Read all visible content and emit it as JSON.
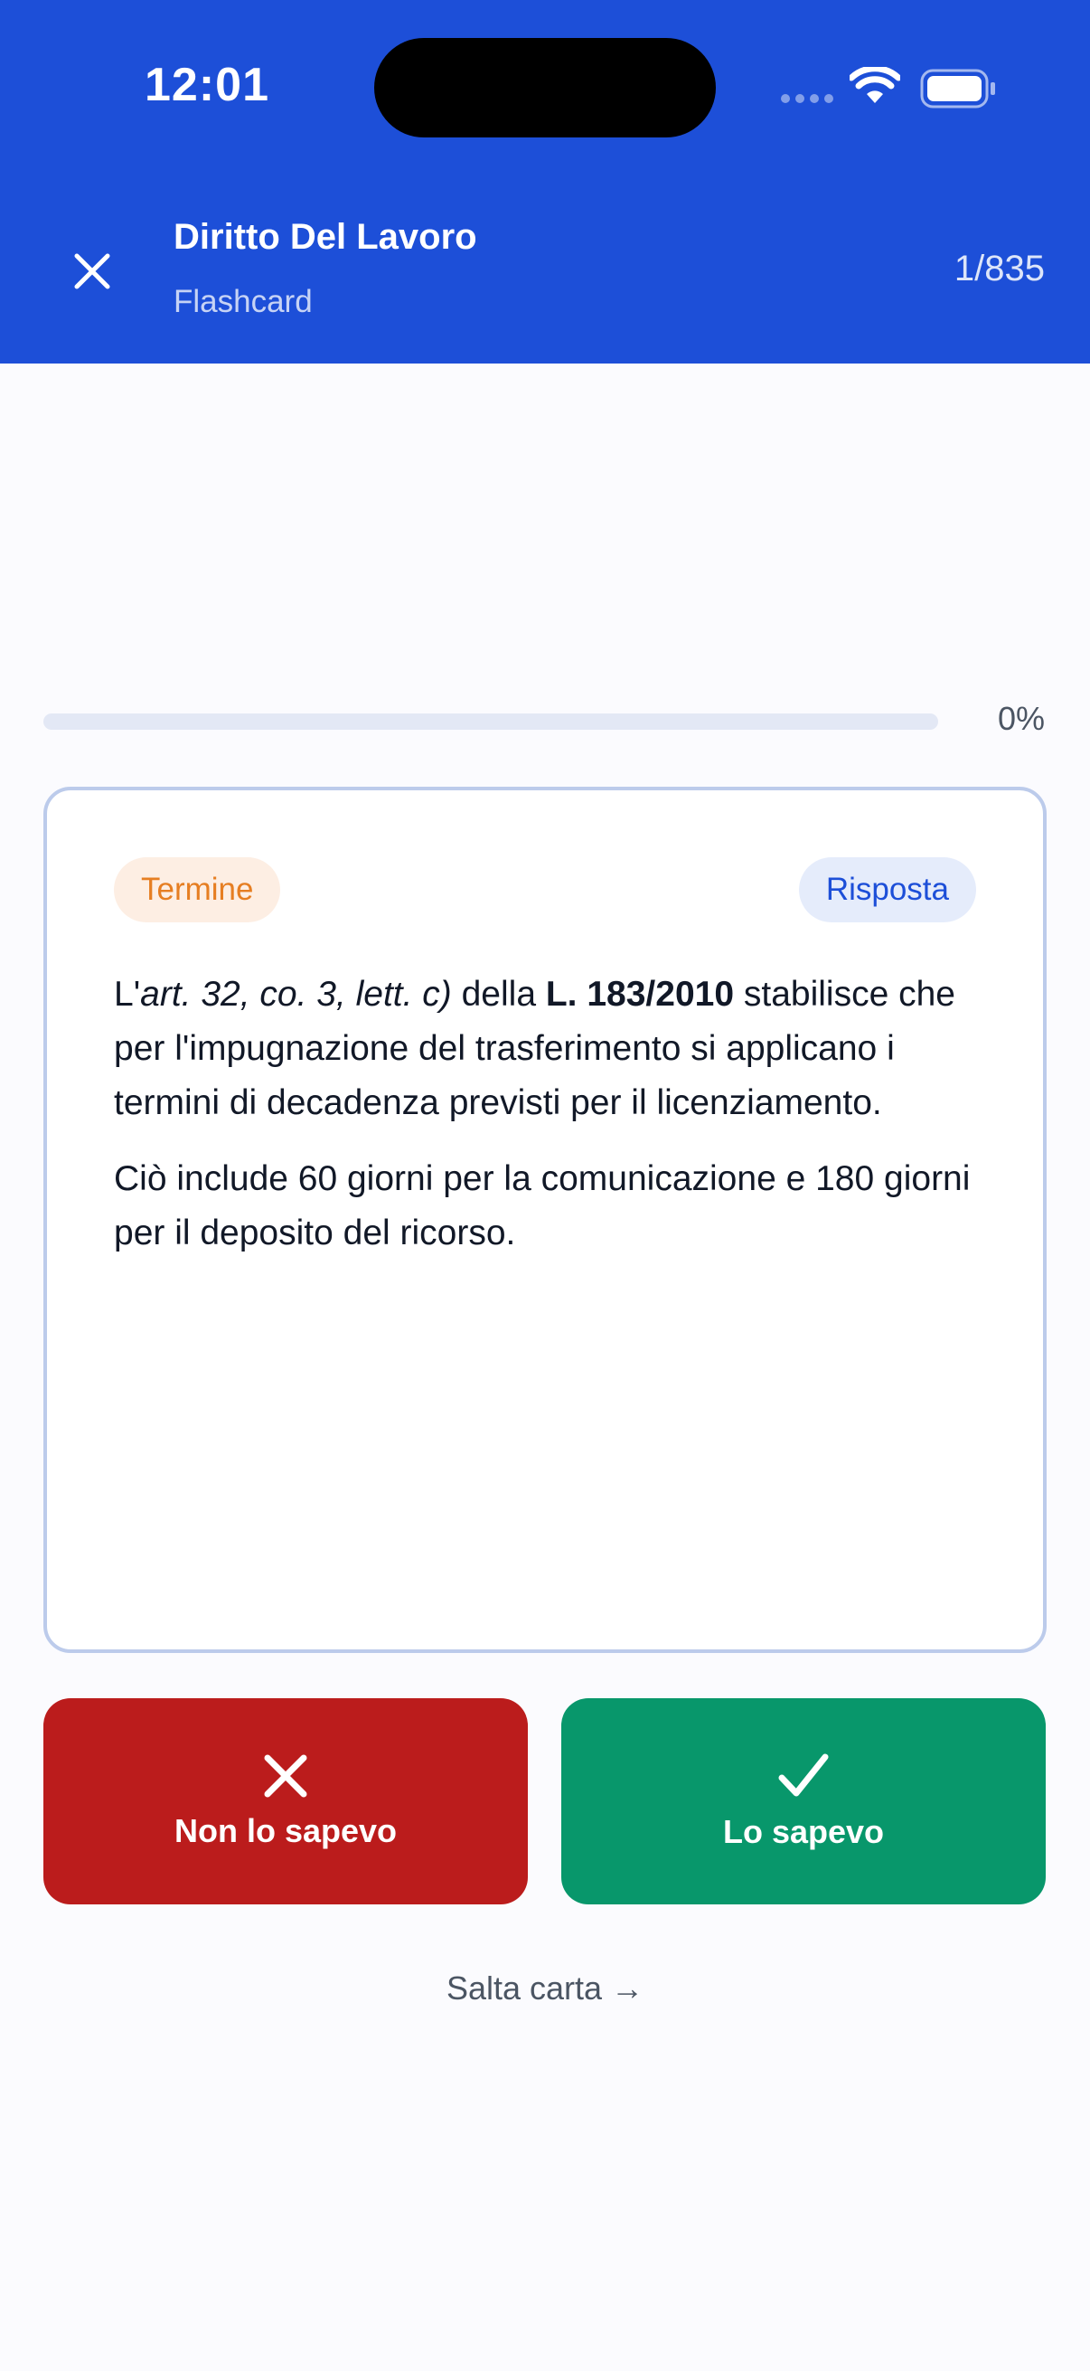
{
  "status_bar": {
    "time": "12:01"
  },
  "header": {
    "title": "Diritto Del Lavoro",
    "subtitle": "Flashcard",
    "counter": "1/835",
    "close_icon": "close-icon",
    "background_color": "#1d4fd8"
  },
  "progress": {
    "value": 0,
    "label": "0%"
  },
  "card": {
    "badge_term": "Termine",
    "badge_answer": "Risposta",
    "paragraph1": {
      "part1": "L'",
      "part2_italic": "art. 32, co. 3, lett. c)",
      "part3": " della ",
      "part4_bold": "L. 183/2010",
      "part5": " stabilisce che per l'impugnazione del trasferimento si applicano i termini di decadenza previsti per il licenziamento."
    },
    "paragraph2": "Ciò include 60 giorni per la comunicazione e 180 giorni per il deposito del ricorso."
  },
  "actions": {
    "unknown_label": "Non lo sapevo",
    "unknown_icon": "close-icon",
    "unknown_color": "#bb1c1c",
    "known_label": "Lo sapevo",
    "known_icon": "checkmark-icon",
    "known_color": "#08976b"
  },
  "skip_label": "Salta carta →"
}
